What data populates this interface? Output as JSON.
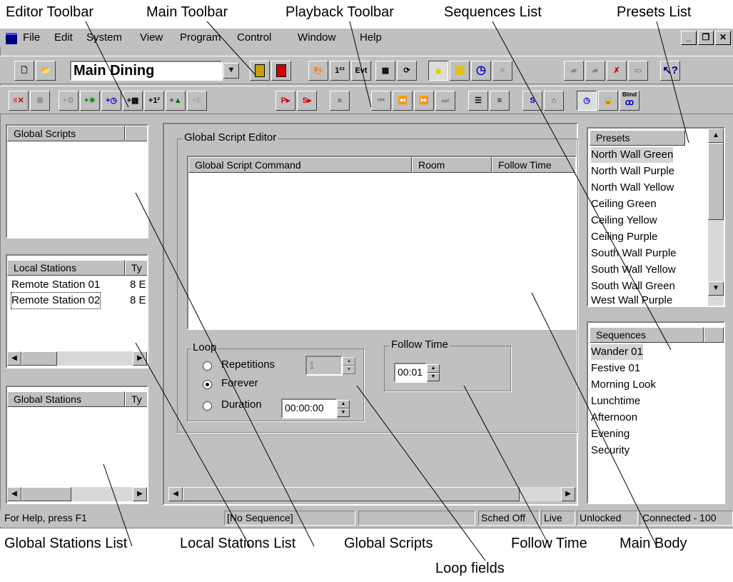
{
  "callouts": {
    "editor_toolbar": "Editor Toolbar",
    "main_toolbar": "Main Toolbar",
    "playback_toolbar": "Playback Toolbar",
    "sequences_list": "Sequences List",
    "presets_list": "Presets List",
    "global_stations_list": "Global Stations List",
    "local_stations_list": "Local Stations List",
    "global_scripts": "Global Scripts",
    "follow_time": "Follow Time",
    "main_body": "Main Body",
    "loop_fields": "Loop fields"
  },
  "menu": {
    "file": "File",
    "edit": "Edit",
    "system": "System",
    "view": "View",
    "program": "Program",
    "control": "Control",
    "window": "Window",
    "help": "Help"
  },
  "toolbar": {
    "room_select_value": "Main Dining",
    "icons_row1": [
      "new-icon",
      "open-icon",
      "room-select",
      "door-icon",
      "door-exit-icon",
      "paint-icon",
      "numbers-icon",
      "event-icon",
      "keypad-icon",
      "refresh-icon",
      "presets-view-icon",
      "sequences-view-icon",
      "clock-icon",
      "scene-icon",
      "tile1-icon",
      "tile2-icon",
      "tile3-icon",
      "tile4-icon",
      "help-icon"
    ],
    "evt_label": "Evt",
    "num_label": "1²³"
  },
  "playback": {
    "play_p": "P",
    "play_s": "S",
    "s_label": "S",
    "blind_label": "Blind"
  },
  "global_scripts_panel": {
    "header": "Global Scripts"
  },
  "local_stations_panel": {
    "headers": [
      "Local Stations",
      "Ty"
    ],
    "rows": [
      {
        "name": "Remote Station 01",
        "type": "8 E"
      },
      {
        "name": "Remote Station 02",
        "type": "8 E"
      }
    ]
  },
  "global_stations_panel": {
    "headers": [
      "Global Stations",
      "Ty"
    ]
  },
  "editor": {
    "group_title": "Global Script Editor",
    "columns": [
      "Global Script Command",
      "Room",
      "Follow Time"
    ],
    "loop": {
      "title": "Loop",
      "repetitions_label": "Repetitions",
      "repetitions_value": "1",
      "forever_label": "Forever",
      "duration_label": "Duration",
      "duration_value": "00:00:00",
      "selected": "Forever"
    },
    "follow_time": {
      "title": "Follow Time",
      "value": "00:01"
    }
  },
  "presets": {
    "header": "Presets",
    "items": [
      "North Wall Green",
      "North Wall Purple",
      "North Wall Yellow",
      "Ceiling Green",
      "Ceiling Yellow",
      "Ceiling Purple",
      "South Wall Purple",
      "South Wall Yellow",
      "South Wall Green",
      "West Wall Purple"
    ],
    "selected_index": 0
  },
  "sequences": {
    "header": "Sequences",
    "items": [
      "Wander 01",
      "Festive 01",
      "Morning Look",
      "Lunchtime",
      "Afternoon",
      "Evening",
      "Security"
    ],
    "selected_index": 0
  },
  "statusbar": {
    "help": "For Help, press F1",
    "sequence": "[No Sequence]",
    "blank": "",
    "sched": "Sched Off",
    "live": "Live",
    "lock": "Unlocked",
    "conn": "Connected - 100"
  },
  "colors": {
    "accent": "#000080",
    "selection": "#d4d4d4",
    "red": "#cc0000",
    "yellow": "#ffff00",
    "blue": "#0000cc"
  }
}
